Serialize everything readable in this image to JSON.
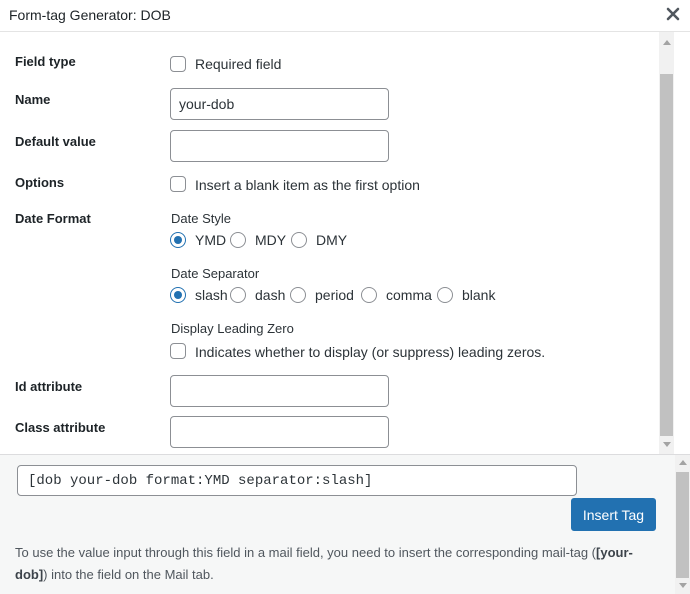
{
  "dialog": {
    "title": "Form-tag Generator: DOB"
  },
  "fields": {
    "field_type": {
      "label": "Field type",
      "required_label": "Required field"
    },
    "name": {
      "label": "Name",
      "value": "your-dob"
    },
    "default_value": {
      "label": "Default value",
      "value": ""
    },
    "options": {
      "label": "Options",
      "checkbox_label": "Insert a blank item as the first option"
    },
    "date_format": {
      "label": "Date Format",
      "date_style": {
        "label": "Date Style",
        "options": [
          "YMD",
          "MDY",
          "DMY"
        ],
        "selected": "YMD"
      },
      "date_separator": {
        "label": "Date Separator",
        "options": [
          "slash",
          "dash",
          "period",
          "comma",
          "blank"
        ],
        "selected": "slash"
      },
      "leading_zero": {
        "label": "Display Leading Zero",
        "checkbox_label": "Indicates whether to display (or suppress) leading zeros."
      }
    },
    "id_attribute": {
      "label": "Id attribute",
      "value": ""
    },
    "class_attribute": {
      "label": "Class attribute",
      "value": ""
    }
  },
  "footer": {
    "tag_output": "[dob your-dob format:YMD separator:slash]",
    "insert_label": "Insert Tag",
    "note_prefix": "To use the value input through this field in a mail field, you need to insert the corresponding mail-tag (",
    "note_tag": "[your-dob]",
    "note_suffix": ") into the field on the Mail tab."
  },
  "colors": {
    "accent": "#2271b1",
    "border": "#8c8f94",
    "footer_bg": "#f6f7f7"
  }
}
